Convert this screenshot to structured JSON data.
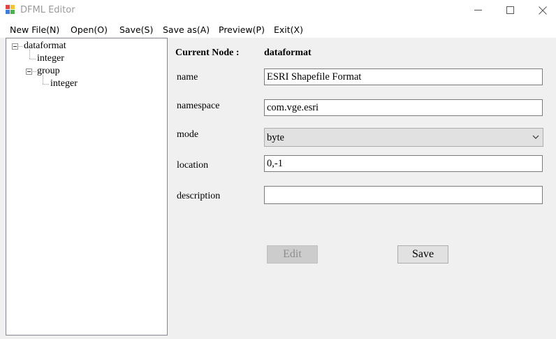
{
  "window": {
    "title": "DFML Editor"
  },
  "menu": {
    "new_file": "New File(N)",
    "open": "Open(O)",
    "save": "Save(S)",
    "save_as": "Save as(A)",
    "preview": "Preview(P)",
    "exit": "Exit(X)"
  },
  "tree": {
    "root": "dataformat",
    "root_child_integer": "integer",
    "group": "group",
    "group_child_integer": "integer"
  },
  "form": {
    "current_node_label": "Current Node :",
    "current_node_value": "dataformat",
    "name_label": "name",
    "name_value": "ESRI Shapefile Format",
    "namespace_label": "namespace",
    "namespace_value": "com.vge.esri",
    "mode_label": "mode",
    "mode_value": "byte",
    "location_label": "location",
    "location_value": "0,-1",
    "description_label": "description",
    "description_value": ""
  },
  "buttons": {
    "edit": "Edit",
    "save": "Save"
  }
}
